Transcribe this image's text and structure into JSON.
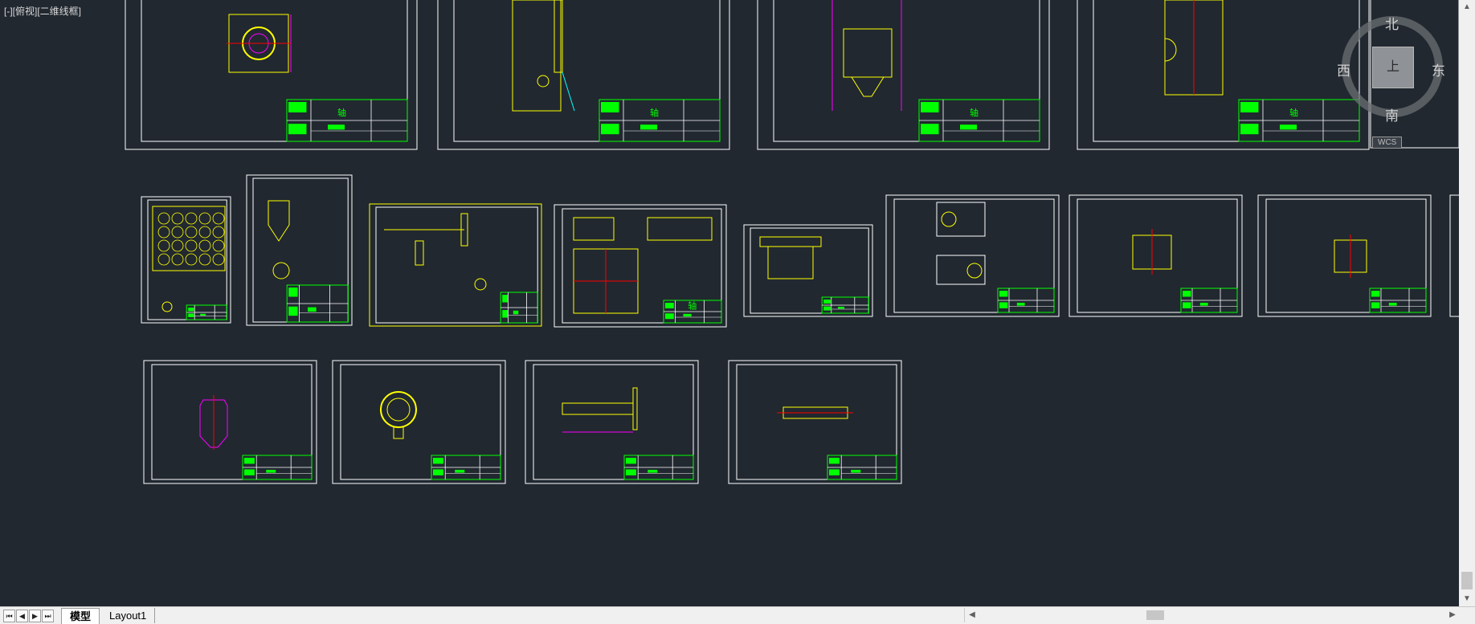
{
  "view_label": "[-][俯视][二维线框]",
  "viewcube": {
    "north": "北",
    "south": "南",
    "west": "西",
    "east": "东",
    "top_face": "上",
    "wcs_label": "WCS"
  },
  "tabs": {
    "model": "模型",
    "layout1": "Layout1"
  },
  "title_block_text": "轴",
  "colors": {
    "background": "#212830",
    "frame": "#ffffff",
    "drawing_yellow": "#ffff00",
    "drawing_magenta": "#ff00ff",
    "drawing_red": "#ff0000",
    "drawing_green": "#00ff00",
    "drawing_cyan": "#00ffff"
  }
}
